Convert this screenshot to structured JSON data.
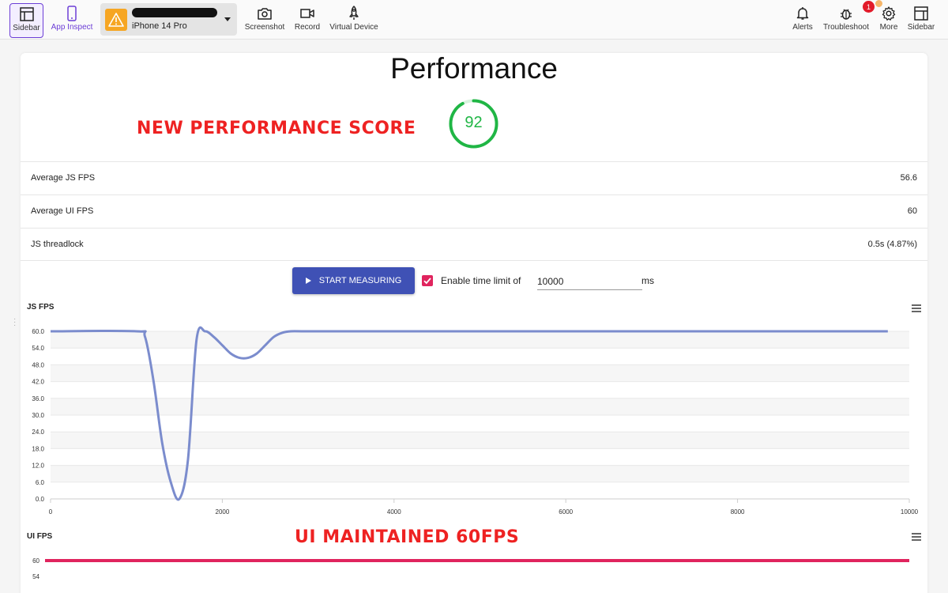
{
  "toolbar": {
    "left": [
      {
        "id": "sidebar-left",
        "label": "Sidebar",
        "icon": "sidebar-panel-icon"
      },
      {
        "id": "app-inspect",
        "label": "App Inspect",
        "icon": "phone-icon"
      }
    ],
    "device": {
      "name": "iPhone 14 Pro",
      "icon": "warning-icon"
    },
    "actions": [
      {
        "id": "screenshot",
        "label": "Screenshot",
        "icon": "camera-icon"
      },
      {
        "id": "record",
        "label": "Record",
        "icon": "video-camera-icon"
      },
      {
        "id": "virtual-device",
        "label": "Virtual Device",
        "icon": "rocket-icon"
      }
    ],
    "right": [
      {
        "id": "alerts",
        "label": "Alerts",
        "icon": "bell-icon"
      },
      {
        "id": "troubleshoot",
        "label": "Troubleshoot",
        "icon": "bug-icon"
      },
      {
        "id": "more",
        "label": "More",
        "icon": "gear-icon"
      },
      {
        "id": "sidebar-right",
        "label": "Sidebar",
        "icon": "sidebar-panel-icon"
      }
    ],
    "troubleshoot_badge": "1"
  },
  "performance": {
    "title": "Performance",
    "score": "92",
    "score_fraction": 0.92,
    "score_color": "#20b645"
  },
  "annotations": {
    "score": "NEW PERFORMANCE SCORE",
    "ui": "UI MAINTAINED 60FPS"
  },
  "metrics": [
    {
      "label": "Average JS FPS",
      "value": "56.6"
    },
    {
      "label": "Average UI FPS",
      "value": "60"
    },
    {
      "label": "JS threadlock",
      "value": "0.5s (4.87%)"
    }
  ],
  "controls": {
    "start_label": "START MEASURING",
    "time_limit_label": "Enable time limit of",
    "time_limit_value": "10000",
    "time_limit_unit": "ms",
    "time_limit_enabled": true
  },
  "colors": {
    "accent": "#3f51b5",
    "js_line": "#7b8ccd",
    "ui_line": "#e0245e",
    "annotation": "#ee2222"
  },
  "chart_data": [
    {
      "type": "line",
      "title": "JS FPS",
      "xlim": [
        0,
        10000
      ],
      "ylim": [
        0,
        60
      ],
      "x_ticks": [
        "0",
        "2000",
        "4000",
        "6000",
        "8000",
        "10000"
      ],
      "y_ticks": [
        "0.0",
        "6.0",
        "12.0",
        "18.0",
        "24.0",
        "30.0",
        "36.0",
        "42.0",
        "48.0",
        "54.0",
        "60.0"
      ],
      "series": [
        {
          "color": "#7b8ccd",
          "x": [
            0,
            1000,
            1100,
            1200,
            1300,
            1400,
            1500,
            1600,
            1700,
            1800,
            1900,
            2000,
            2100,
            2200,
            2300,
            2400,
            2500,
            2600,
            2700,
            2800,
            3000,
            4000,
            5000,
            6000,
            7000,
            8000,
            9000,
            9750
          ],
          "y": [
            60,
            60,
            58,
            42,
            20,
            6,
            0,
            14,
            57,
            60,
            58,
            55,
            52,
            50.5,
            50.5,
            52,
            55,
            58,
            59.5,
            60,
            60,
            60,
            60,
            60,
            60,
            60,
            60,
            60
          ]
        }
      ],
      "grid": true
    },
    {
      "type": "line",
      "title": "UI FPS",
      "y_ticks": [
        "60",
        "54"
      ],
      "series": [
        {
          "color": "#e0245e",
          "x": [
            0,
            10000
          ],
          "y": [
            60,
            60
          ]
        }
      ],
      "grid": false
    }
  ]
}
